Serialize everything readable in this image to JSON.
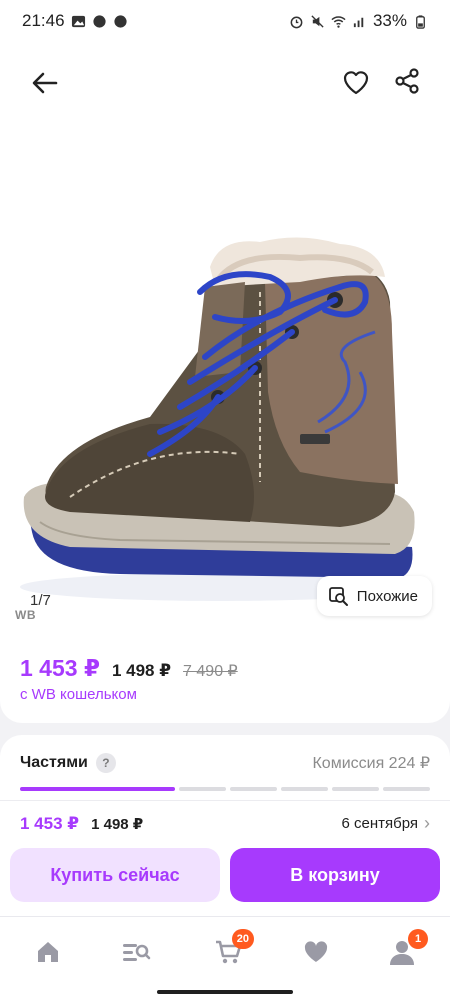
{
  "status_bar": {
    "time": "21:46",
    "battery": "33%"
  },
  "gallery": {
    "counter": "1/7",
    "wb_mark": "WB",
    "similar_label": "Похожие"
  },
  "price": {
    "main": "1 453 ₽",
    "mid": "1 498 ₽",
    "old": "7 490 ₽",
    "wallet_note": "с WB кошельком"
  },
  "installments": {
    "title": "Частями",
    "help": "?",
    "commission": "Комиссия 224 ₽",
    "progress": {
      "active_segments": 1,
      "total_segments": 6
    }
  },
  "delivery": {
    "price": "1 453 ₽",
    "mid": "1 498 ₽",
    "date": "6 сентября"
  },
  "actions": {
    "buy_now": "Купить сейчас",
    "add_to_cart": "В корзину"
  },
  "tabbar": {
    "cart_badge": "20",
    "profile_badge": "1"
  },
  "colors": {
    "accent": "#a73afd",
    "accent_soft": "#f1e1ff",
    "badge": "#ff5a1f"
  }
}
